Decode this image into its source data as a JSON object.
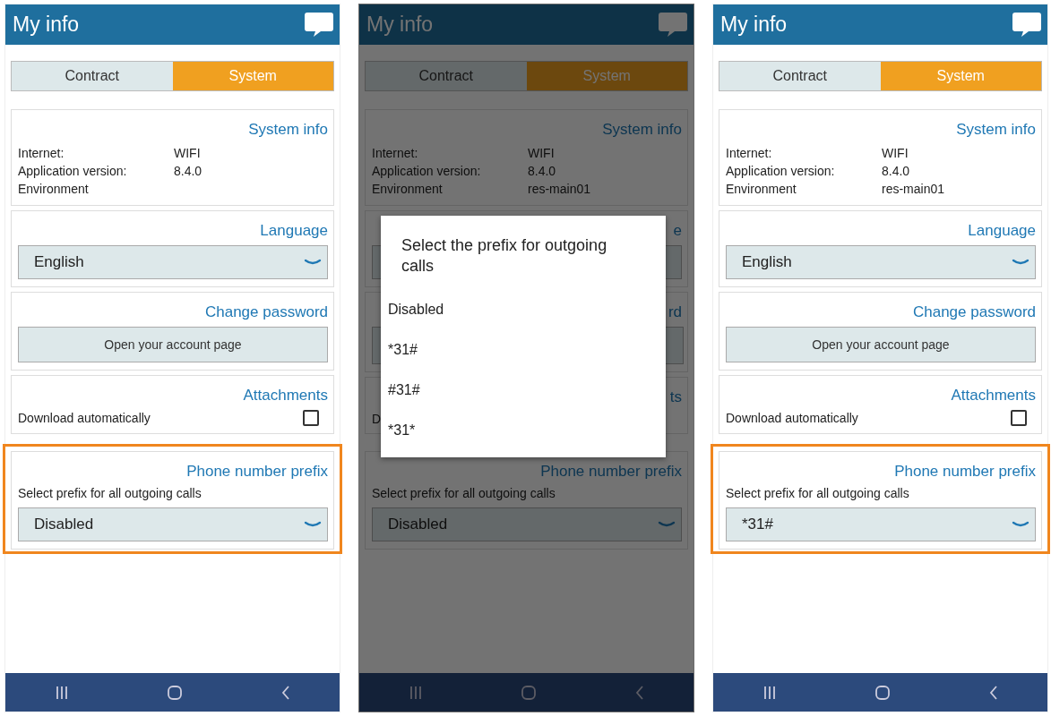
{
  "screens": [
    {
      "header": {
        "title": "My info"
      },
      "tabs": [
        {
          "label": "Contract",
          "selected": false
        },
        {
          "label": "System",
          "selected": true
        }
      ],
      "system_info": {
        "title": "System info",
        "rows": [
          {
            "label": "Internet:",
            "value": "WIFI"
          },
          {
            "label": "Application version:",
            "value": "8.4.0"
          },
          {
            "label": "Environment"
          }
        ]
      },
      "language": {
        "title": "Language",
        "value": "English"
      },
      "change_password": {
        "title": "Change password",
        "button": "Open your account page"
      },
      "attachments": {
        "title": "Attachments",
        "label": "Download automatically",
        "checked": false
      },
      "phone_prefix": {
        "title": "Phone number prefix",
        "hint": "Select prefix for all outgoing calls",
        "value": "Disabled",
        "highlighted": true
      }
    },
    {
      "header": {
        "title": "My info"
      },
      "tabs": [
        {
          "label": "Contract",
          "selected": false
        },
        {
          "label": "System",
          "selected": true
        }
      ],
      "system_info": {
        "title": "System info",
        "rows": [
          {
            "label": "Internet:",
            "value": "WIFI"
          },
          {
            "label": "Application version:",
            "value": "8.4.0"
          },
          {
            "label": "Environment",
            "value": "res-main01"
          }
        ]
      },
      "language": {
        "title": "e"
      },
      "change_password": {
        "title": "rd"
      },
      "attachments": {
        "title": "ts",
        "label": "D"
      },
      "phone_prefix": {
        "title": "Phone number prefix",
        "hint": "Select prefix for all outgoing calls",
        "value": "Disabled",
        "highlighted": false
      },
      "dialog": {
        "title": "Select the prefix for outgoing calls",
        "options": [
          "Disabled",
          "*31#",
          "#31#",
          "*31*"
        ]
      }
    },
    {
      "header": {
        "title": "My info"
      },
      "tabs": [
        {
          "label": "Contract",
          "selected": false
        },
        {
          "label": "System",
          "selected": true
        }
      ],
      "system_info": {
        "title": "System info",
        "rows": [
          {
            "label": "Internet:",
            "value": "WIFI"
          },
          {
            "label": "Application version:",
            "value": "8.4.0"
          },
          {
            "label": "Environment",
            "value": "res-main01"
          }
        ]
      },
      "language": {
        "title": "Language",
        "value": "English"
      },
      "change_password": {
        "title": "Change password",
        "button": "Open your account page"
      },
      "attachments": {
        "title": "Attachments",
        "label": "Download automatically",
        "checked": false
      },
      "phone_prefix": {
        "title": "Phone number prefix",
        "hint": "Select prefix for all outgoing calls",
        "value": "*31#",
        "highlighted": true
      }
    }
  ]
}
